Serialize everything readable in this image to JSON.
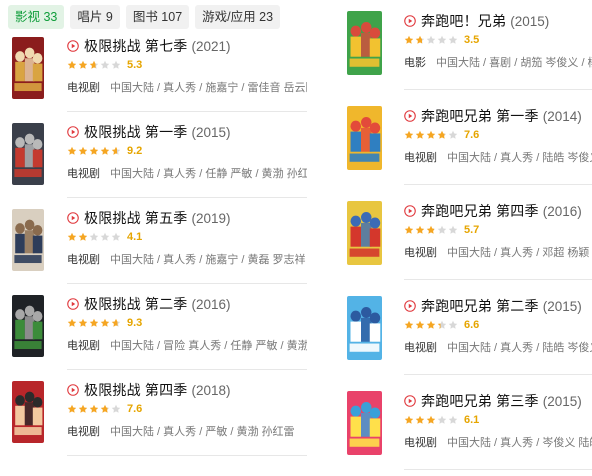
{
  "tabs": [
    {
      "label": "影视 33",
      "active": true
    },
    {
      "label": "唱片 9",
      "active": false
    },
    {
      "label": "图书 107",
      "active": false
    },
    {
      "label": "游戏/应用 23",
      "active": false
    }
  ],
  "colors": {
    "accent": "#0f9d3a",
    "star": "#f5a623",
    "star_empty": "#d8d8d8",
    "play": "#e0393e"
  },
  "left_items": [
    {
      "title": "极限挑战 第七季",
      "year": "(2021)",
      "rating": 5.3,
      "score": "5.3",
      "type": "电视剧",
      "meta": "中国大陆 / 真人秀 / 施嘉宁 / 雷佳音 岳云鹏",
      "poster": {
        "bg": "#8b1d1d",
        "fg": "#d9a441",
        "alt": "#f0d9b0"
      }
    },
    {
      "title": "极限挑战 第一季",
      "year": "(2015)",
      "rating": 9.2,
      "score": "9.2",
      "type": "电视剧",
      "meta": "中国大陆 / 真人秀 / 任静 严敏 / 黄渤 孙红雷",
      "poster": {
        "bg": "#3a3f4a",
        "fg": "#c43a2f",
        "alt": "#b9b9b9"
      }
    },
    {
      "title": "极限挑战 第五季",
      "year": "(2019)",
      "rating": 4.1,
      "score": "4.1",
      "type": "电视剧",
      "meta": "中国大陆 / 真人秀 / 施嘉宁 / 黄磊 罗志祥",
      "poster": {
        "bg": "#d9cfc0",
        "fg": "#2e3d5a",
        "alt": "#8a6b4e"
      }
    },
    {
      "title": "极限挑战 第二季",
      "year": "(2016)",
      "rating": 9.3,
      "score": "9.3",
      "type": "电视剧",
      "meta": "中国大陆 / 冒险 真人秀 / 任静 严敏 / 黄渤 孙...",
      "poster": {
        "bg": "#1f2226",
        "fg": "#3c8c3a",
        "alt": "#a8a8a8"
      }
    },
    {
      "title": "极限挑战 第四季",
      "year": "(2018)",
      "rating": 7.6,
      "score": "7.6",
      "type": "电视剧",
      "meta": "中国大陆 / 真人秀 / 严敏 / 黄渤 孙红雷",
      "poster": {
        "bg": "#b8262a",
        "fg": "#f3c9a0",
        "alt": "#2b2b2b"
      }
    }
  ],
  "right_items": [
    {
      "title": "奔跑吧！兄弟",
      "year": "(2015)",
      "rating": 3.5,
      "score": "3.5",
      "type": "电影",
      "meta": "中国大陆 / 喜剧 / 胡笳 岑俊义 / 杨颖",
      "poster": {
        "bg": "#3fa34a",
        "fg": "#f2c230",
        "alt": "#d94b3c"
      }
    },
    {
      "title": "奔跑吧兄弟 第一季",
      "year": "(2014)",
      "rating": 7.6,
      "score": "7.6",
      "type": "电视剧",
      "meta": "中国大陆 / 真人秀 / 陆皓 岑俊义 / 邓",
      "poster": {
        "bg": "#f0b72c",
        "fg": "#2f7fc1",
        "alt": "#e34a3a"
      }
    },
    {
      "title": "奔跑吧兄弟 第四季",
      "year": "(2016)",
      "rating": 5.7,
      "score": "5.7",
      "type": "电视剧",
      "meta": "中国大陆 / 真人秀 / 邓超 杨颖",
      "poster": {
        "bg": "#e8c640",
        "fg": "#d4372c",
        "alt": "#3b6bb5"
      }
    },
    {
      "title": "奔跑吧兄弟 第二季",
      "year": "(2015)",
      "rating": 6.6,
      "score": "6.6",
      "type": "电视剧",
      "meta": "中国大陆 / 真人秀 / 陆皓 岑俊义 / 邓",
      "poster": {
        "bg": "#53b3e6",
        "fg": "#ffffff",
        "alt": "#2c5aa0"
      }
    },
    {
      "title": "奔跑吧兄弟 第三季",
      "year": "(2015)",
      "rating": 6.1,
      "score": "6.1",
      "type": "电视剧",
      "meta": "中国大陆 / 真人秀 / 岑俊义 陆皓",
      "poster": {
        "bg": "#e9426a",
        "fg": "#ffe04a",
        "alt": "#3aa0d8"
      }
    }
  ]
}
